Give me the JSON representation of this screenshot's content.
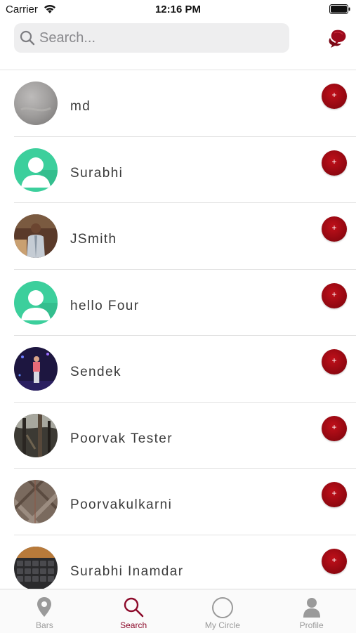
{
  "status_bar": {
    "carrier": "Carrier",
    "time": "12:16 PM"
  },
  "search": {
    "placeholder": "Search...",
    "value": ""
  },
  "header": {
    "chat_icon": "chat-bubbles-icon"
  },
  "users": [
    {
      "name": "md",
      "avatar": "grey-photo"
    },
    {
      "name": "Surabhi",
      "avatar": "default-silhouette"
    },
    {
      "name": "JSmith",
      "avatar": "person-photo"
    },
    {
      "name": "hello Four",
      "avatar": "default-silhouette"
    },
    {
      "name": "Sendek",
      "avatar": "stage-photo"
    },
    {
      "name": "Poorvak Tester",
      "avatar": "forest-photo"
    },
    {
      "name": "Poorvakulkarni",
      "avatar": "plaid-photo"
    },
    {
      "name": "Surabhi Inamdar",
      "avatar": "keyboard-photo"
    }
  ],
  "add_button_symbol": "+",
  "tabs": [
    {
      "label": "Bars",
      "icon": "location-pin-icon",
      "active": false
    },
    {
      "label": "Search",
      "icon": "search-icon",
      "active": true
    },
    {
      "label": "My Circle",
      "icon": "circle-icon",
      "active": false
    },
    {
      "label": "Profile",
      "icon": "person-icon",
      "active": false
    }
  ],
  "colors": {
    "accent": "#8c0a2a",
    "add_button": "#a50a14",
    "silhouette_bg": "#3ccf9c",
    "tab_inactive": "#9a9a9a"
  }
}
